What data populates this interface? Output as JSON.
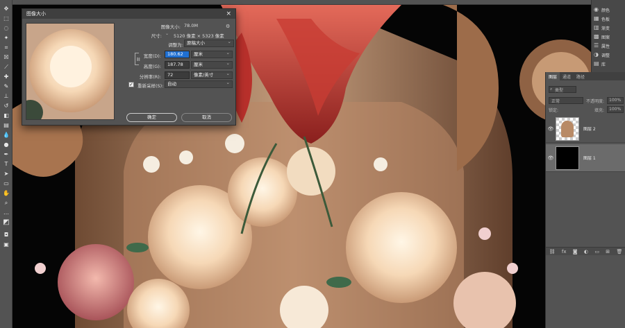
{
  "dialog": {
    "title": "图像大小",
    "close": "×",
    "image_size_label": "图像大小:",
    "image_size_value": "78.0M",
    "dimensions_label": "尺寸:",
    "dimensions_value": "5120 像素 × 5323 像素",
    "fit_to_label": "调整为:",
    "fit_to_value": "原稿大小",
    "width_label": "宽度(D):",
    "width_value": "180.62",
    "width_unit": "厘米",
    "height_label": "高度(G):",
    "height_value": "187.78",
    "height_unit": "厘米",
    "resolution_label": "分辨率(R):",
    "resolution_value": "72",
    "resolution_unit": "像素/英寸",
    "resample_label": "重新采样(S):",
    "resample_value": "自动",
    "ok_label": "确定",
    "cancel_label": "取消"
  },
  "right_panel": {
    "items": [
      {
        "label": "颜色",
        "icon": "palette-icon"
      },
      {
        "label": "色板",
        "icon": "grid-icon"
      },
      {
        "label": "渐变",
        "icon": "gradient-icon"
      },
      {
        "label": "图案",
        "icon": "pattern-icon"
      },
      {
        "label": "属性",
        "icon": "properties-icon"
      },
      {
        "label": "调整",
        "icon": "adjust-icon"
      },
      {
        "label": "库",
        "icon": "library-icon"
      }
    ]
  },
  "layers_panel": {
    "tabs": [
      "图层",
      "通道",
      "路径"
    ],
    "search_placeholder": "类型",
    "blend_mode": "正常",
    "opacity_label": "不透明度:",
    "opacity_value": "100%",
    "lock_label": "锁定:",
    "fill_label": "填充:",
    "fill_value": "100%",
    "layers": [
      {
        "name": "图层 2",
        "selected": false
      },
      {
        "name": "图层 1",
        "selected": true
      }
    ]
  },
  "colors": {
    "ui_bg": "#535353",
    "highlight": "#1f6fd1",
    "canvas_bg": "#050505"
  }
}
